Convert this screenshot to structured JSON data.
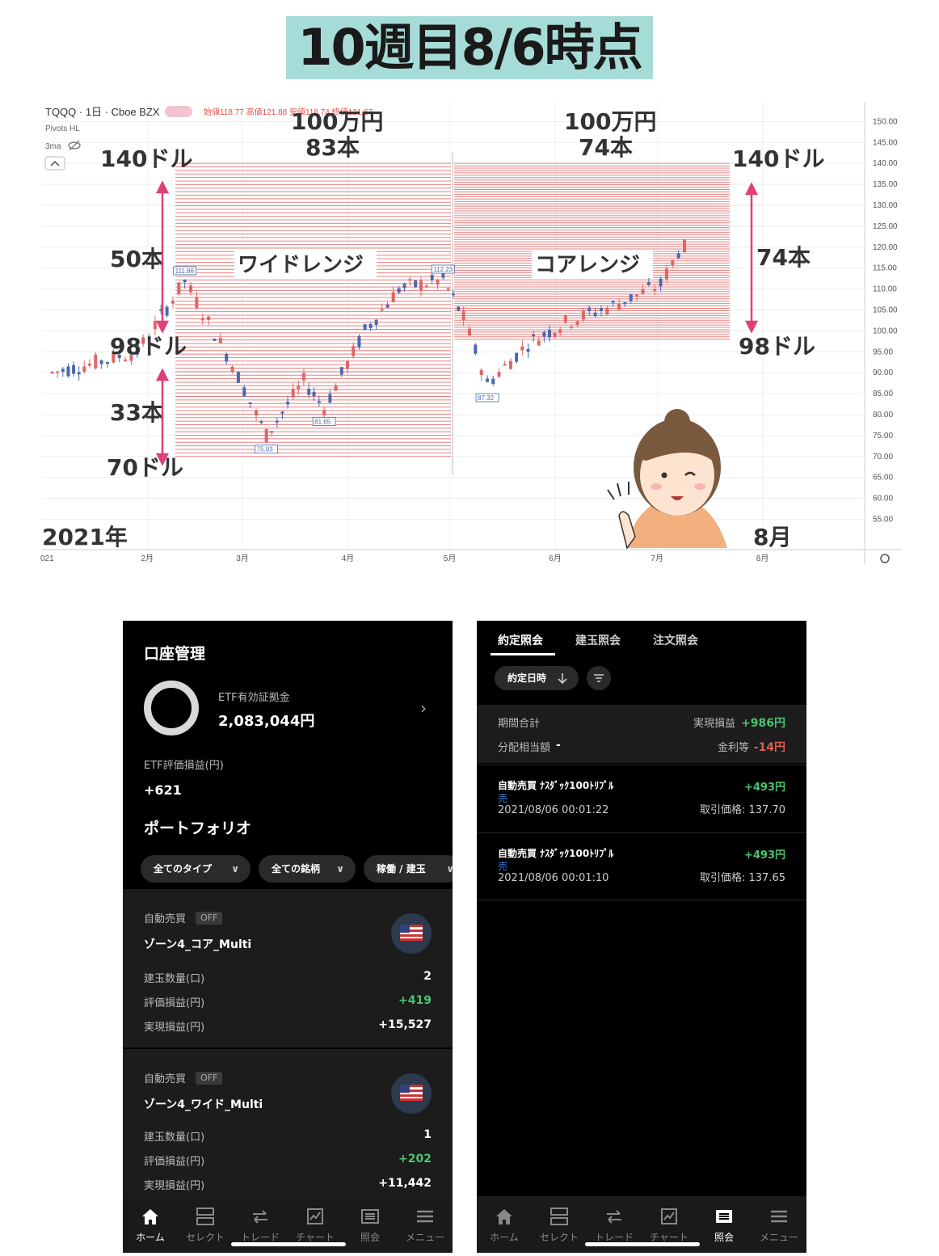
{
  "title": "10週目8/6時点",
  "chart_header": {
    "symbol": "TQQQ · 1日 · Cboe BZX",
    "indicator1": "Pivots HL",
    "indicator2": "3ma",
    "ohlc": "始値118.77  高値121.88  安値118.74  終値121.67"
  },
  "chart_annotations": {
    "wide_amount": "100万円",
    "wide_count": "83本",
    "core_amount": "100万円",
    "core_count": "74本",
    "left_top_price": "140ドル",
    "left_count_upper": "50本",
    "left_mid_price": "98ドル",
    "left_count_lower": "33本",
    "left_bottom_price": "70ドル",
    "right_top_price": "140ドル",
    "right_count": "74本",
    "right_bottom_price": "98ドル",
    "wide_label": "ワイドレンジ",
    "core_label": "コアレンジ",
    "year_label": "2021年",
    "month_label": "8月"
  },
  "chart_data": {
    "type": "line",
    "title": "",
    "y_ticks": [
      "150.00",
      "145.00",
      "140.00",
      "135.00",
      "130.00",
      "125.00",
      "120.00",
      "115.00",
      "110.00",
      "105.00",
      "100.00",
      "95.00",
      "90.00",
      "85.00",
      "80.00",
      "75.00",
      "70.00",
      "65.00",
      "60.00",
      "55.00"
    ],
    "x_ticks": [
      "021",
      "2月",
      "3月",
      "4月",
      "5月",
      "6月",
      "7月",
      "8月"
    ],
    "ylim": [
      52,
      152
    ],
    "pivot_labels": [
      "111.86",
      "75.03",
      "81.65",
      "112.23",
      "87.32"
    ],
    "price_path": [
      {
        "x": "2021-01-04",
        "y": 90
      },
      {
        "x": "2021-01-15",
        "y": 92
      },
      {
        "x": "2021-01-29",
        "y": 95
      },
      {
        "x": "2021-02-12",
        "y": 111.86
      },
      {
        "x": "2021-02-26",
        "y": 92
      },
      {
        "x": "2021-03-05",
        "y": 80
      },
      {
        "x": "2021-03-08",
        "y": 75.03
      },
      {
        "x": "2021-03-19",
        "y": 88
      },
      {
        "x": "2021-03-25",
        "y": 81.65
      },
      {
        "x": "2021-04-06",
        "y": 100
      },
      {
        "x": "2021-04-16",
        "y": 110
      },
      {
        "x": "2021-04-29",
        "y": 112.23
      },
      {
        "x": "2021-05-05",
        "y": 103
      },
      {
        "x": "2021-05-12",
        "y": 87.32
      },
      {
        "x": "2021-05-24",
        "y": 97
      },
      {
        "x": "2021-06-04",
        "y": 102
      },
      {
        "x": "2021-06-18",
        "y": 106
      },
      {
        "x": "2021-07-02",
        "y": 111
      },
      {
        "x": "2021-07-09",
        "y": 121.67
      }
    ],
    "grid": true
  },
  "account": {
    "title": "口座管理",
    "etf_label": "ETF有効証拠金",
    "etf_value": "2,083,044円",
    "eval_label": "ETF評価損益(円)",
    "eval_value": "+621",
    "portfolio_title": "ポートフォリオ",
    "filters": [
      "全てのタイプ",
      "全ての銘柄",
      "稼働 / 建玉"
    ]
  },
  "positions": [
    {
      "auto_label": "自動売買",
      "status": "OFF",
      "name": "ゾーン4_コア_Multi",
      "qty_label": "建玉数量(口)",
      "qty": "2",
      "eval_label": "評価損益(円)",
      "eval": "+419",
      "realized_label": "実現損益(円)",
      "realized": "+15,527"
    },
    {
      "auto_label": "自動売買",
      "status": "OFF",
      "name": "ゾーン4_ワイド_Multi",
      "qty_label": "建玉数量(口)",
      "qty": "1",
      "eval_label": "評価損益(円)",
      "eval": "+202",
      "realized_label": "実現損益(円)",
      "realized": "+11,442"
    }
  ],
  "nav": {
    "items": [
      "ホーム",
      "セレクト",
      "トレード",
      "チャート",
      "照会",
      "メニュー"
    ]
  },
  "history": {
    "tabs": [
      "約定照会",
      "建玉照会",
      "注文照会"
    ],
    "sort_label": "約定日時",
    "period_label": "期間合計",
    "realized_label": "実現損益",
    "realized_value": "+986円",
    "dividend_label": "分配相当額",
    "dividend_value": "-",
    "interest_label": "金利等",
    "interest_value": "-14円",
    "trades": [
      {
        "name": "自動売買 ﾅｽﾀﾞｯｸ100ﾄﾘﾌﾟﾙ",
        "side": "売",
        "time": "2021/08/06 00:01:22",
        "pnl": "+493円",
        "price": "取引価格: 137.70"
      },
      {
        "name": "自動売買 ﾅｽﾀﾞｯｸ100ﾄﾘﾌﾟﾙ",
        "side": "売",
        "time": "2021/08/06 00:01:10",
        "pnl": "+493円",
        "price": "取引価格: 137.65"
      }
    ]
  },
  "colors": {
    "title_bg": "#a6dcd8",
    "grid_red": "#e88080",
    "arrow": "#e0407a",
    "up": "#e06666",
    "down": "#4a68b0",
    "gain": "#4cc36f",
    "loss": "#e25b4e"
  },
  "icons": [
    "home-icon",
    "select-icon",
    "trade-icon",
    "chart-icon",
    "list-icon",
    "menu-icon",
    "us-flag-icon",
    "chevron-right-icon",
    "sort-down-icon",
    "filter-icon"
  ]
}
